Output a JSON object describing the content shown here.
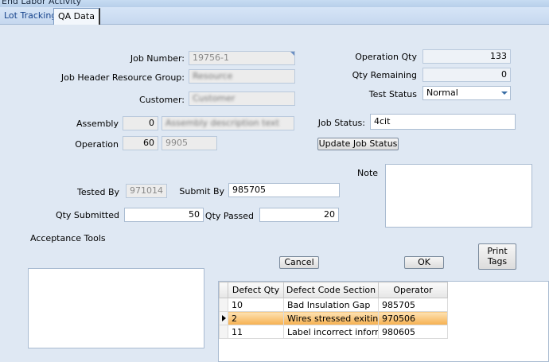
{
  "window": {
    "title": "End Labor Activity"
  },
  "tabs": [
    {
      "label": "Lot Tracking",
      "active": false
    },
    {
      "label": "QA Data",
      "active": true
    }
  ],
  "form": {
    "job_number": {
      "label": "Job Number:",
      "value": "19756-1"
    },
    "job_header_resource_group": {
      "label": "Job Header Resource Group:",
      "value": "Resource"
    },
    "customer": {
      "label": "Customer:",
      "value": "Customer"
    },
    "assembly": {
      "label": "Assembly",
      "seq": "0",
      "description": "Assembly description text"
    },
    "operation": {
      "label": "Operation",
      "seq": "60",
      "code": "9905"
    },
    "operation_qty": {
      "label": "Operation Qty",
      "value": "133"
    },
    "qty_remaining": {
      "label": "Qty Remaining",
      "value": "0"
    },
    "test_status": {
      "label": "Test Status",
      "value": "Normal"
    },
    "job_status": {
      "label": "Job Status:",
      "value": "4cit"
    },
    "update_job_status_label": "Update Job Status",
    "note": {
      "label": "Note",
      "value": ""
    },
    "tested_by": {
      "label": "Tested By",
      "value": "971014"
    },
    "submit_by": {
      "label": "Submit By",
      "value": "985705"
    },
    "qty_submitted": {
      "label": "Qty Submitted",
      "value": "50"
    },
    "qty_passed": {
      "label": "Qty Passed",
      "value": "20"
    },
    "acceptance_tools": {
      "label": "Acceptance Tools"
    },
    "cancel_label": "Cancel",
    "ok_label": "OK",
    "print_tags_line1": "Print",
    "print_tags_line2": "Tags"
  },
  "defects": {
    "columns": [
      "Defect Qty",
      "Defect Code Section",
      "Operator"
    ],
    "rows": [
      {
        "qty": "10",
        "code": "Bad Insulation Gap",
        "operator": "985705",
        "selected": false
      },
      {
        "qty": "2",
        "code": "Wires stressed exiting",
        "operator": "970506",
        "selected": true
      },
      {
        "qty": "11",
        "code": "Label incorrect informati",
        "operator": "980605",
        "selected": false
      }
    ]
  },
  "colors": {
    "background": "#dfe8f3",
    "selected_row": "#f6b04f",
    "tab_text": "#15428b"
  }
}
